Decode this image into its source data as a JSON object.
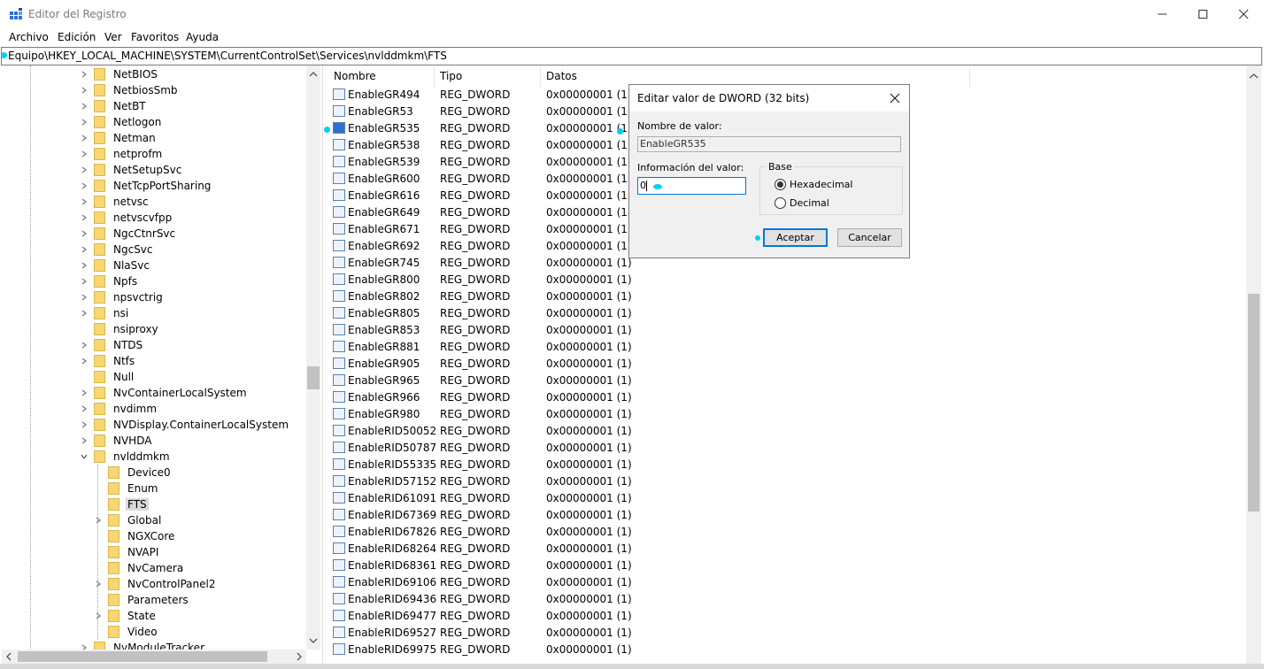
{
  "window": {
    "title": "Editor del Registro"
  },
  "menu": [
    "Archivo",
    "Edición",
    "Ver",
    "Favoritos",
    "Ayuda"
  ],
  "address": "Equipo\\HKEY_LOCAL_MACHINE\\SYSTEM\\CurrentControlSet\\Services\\nvlddmkm\\FTS",
  "tree": {
    "top_level": [
      "NetBIOS",
      "NetbiosSmb",
      "NetBT",
      "Netlogon",
      "Netman",
      "netprofm",
      "NetSetupSvc",
      "NetTcpPortSharing",
      "netvsc",
      "netvscvfpp",
      "NgcCtnrSvc",
      "NgcSvc",
      "NlaSvc",
      "Npfs",
      "npsvctrig",
      "nsi",
      "nsiproxy",
      "NTDS",
      "Ntfs",
      "Null",
      "NvContainerLocalSystem",
      "nvdimm",
      "NVDisplay.ContainerLocalSystem",
      "NVHDA",
      "nvlddmkm"
    ],
    "children": [
      "Device0",
      "Enum",
      "FTS",
      "Global",
      "NGXCore",
      "NVAPI",
      "NvCamera",
      "NvControlPanel2",
      "Parameters",
      "State",
      "Video"
    ],
    "after": "NvModuleTracker",
    "selected": "FTS"
  },
  "list": {
    "headers": {
      "name": "Nombre",
      "type": "Tipo",
      "data": "Datos"
    },
    "rows": [
      {
        "name": "EnableGR494",
        "type": "REG_DWORD",
        "data": "0x00000001 (1)"
      },
      {
        "name": "EnableGR53",
        "type": "REG_DWORD",
        "data": "0x00000001 (1)"
      },
      {
        "name": "EnableGR535",
        "type": "REG_DWORD",
        "data": "0x00000001 (1)"
      },
      {
        "name": "EnableGR538",
        "type": "REG_DWORD",
        "data": "0x00000001 (1)"
      },
      {
        "name": "EnableGR539",
        "type": "REG_DWORD",
        "data": "0x00000001 (1)"
      },
      {
        "name": "EnableGR600",
        "type": "REG_DWORD",
        "data": "0x00000001 (1)"
      },
      {
        "name": "EnableGR616",
        "type": "REG_DWORD",
        "data": "0x00000001 (1)"
      },
      {
        "name": "EnableGR649",
        "type": "REG_DWORD",
        "data": "0x00000001 (1)"
      },
      {
        "name": "EnableGR671",
        "type": "REG_DWORD",
        "data": "0x00000001 (1)"
      },
      {
        "name": "EnableGR692",
        "type": "REG_DWORD",
        "data": "0x00000001 (1)"
      },
      {
        "name": "EnableGR745",
        "type": "REG_DWORD",
        "data": "0x00000001 (1)"
      },
      {
        "name": "EnableGR800",
        "type": "REG_DWORD",
        "data": "0x00000001 (1)"
      },
      {
        "name": "EnableGR802",
        "type": "REG_DWORD",
        "data": "0x00000001 (1)"
      },
      {
        "name": "EnableGR805",
        "type": "REG_DWORD",
        "data": "0x00000001 (1)"
      },
      {
        "name": "EnableGR853",
        "type": "REG_DWORD",
        "data": "0x00000001 (1)"
      },
      {
        "name": "EnableGR881",
        "type": "REG_DWORD",
        "data": "0x00000001 (1)"
      },
      {
        "name": "EnableGR905",
        "type": "REG_DWORD",
        "data": "0x00000001 (1)"
      },
      {
        "name": "EnableGR965",
        "type": "REG_DWORD",
        "data": "0x00000001 (1)"
      },
      {
        "name": "EnableGR966",
        "type": "REG_DWORD",
        "data": "0x00000001 (1)"
      },
      {
        "name": "EnableGR980",
        "type": "REG_DWORD",
        "data": "0x00000001 (1)"
      },
      {
        "name": "EnableRID50052",
        "type": "REG_DWORD",
        "data": "0x00000001 (1)"
      },
      {
        "name": "EnableRID50787",
        "type": "REG_DWORD",
        "data": "0x00000001 (1)"
      },
      {
        "name": "EnableRID55335",
        "type": "REG_DWORD",
        "data": "0x00000001 (1)"
      },
      {
        "name": "EnableRID57152",
        "type": "REG_DWORD",
        "data": "0x00000001 (1)"
      },
      {
        "name": "EnableRID61091",
        "type": "REG_DWORD",
        "data": "0x00000001 (1)"
      },
      {
        "name": "EnableRID67369",
        "type": "REG_DWORD",
        "data": "0x00000001 (1)"
      },
      {
        "name": "EnableRID67826",
        "type": "REG_DWORD",
        "data": "0x00000001 (1)"
      },
      {
        "name": "EnableRID68264",
        "type": "REG_DWORD",
        "data": "0x00000001 (1)"
      },
      {
        "name": "EnableRID68361",
        "type": "REG_DWORD",
        "data": "0x00000001 (1)"
      },
      {
        "name": "EnableRID69106",
        "type": "REG_DWORD",
        "data": "0x00000001 (1)"
      },
      {
        "name": "EnableRID69436",
        "type": "REG_DWORD",
        "data": "0x00000001 (1)"
      },
      {
        "name": "EnableRID69477",
        "type": "REG_DWORD",
        "data": "0x00000001 (1)"
      },
      {
        "name": "EnableRID69527",
        "type": "REG_DWORD",
        "data": "0x00000001 (1)"
      },
      {
        "name": "EnableRID69975",
        "type": "REG_DWORD",
        "data": "0x00000001 (1)"
      }
    ],
    "selected": "EnableGR535",
    "icon_glyph": "011 110"
  },
  "dialog": {
    "title": "Editar valor de DWORD (32 bits)",
    "name_label": "Nombre de valor:",
    "name_value": "EnableGR535",
    "data_label": "Información del valor:",
    "data_value": "0",
    "base_label": "Base",
    "hex_label": "Hexadecimal",
    "dec_label": "Decimal",
    "base_selected": "Hexadecimal",
    "ok_label": "Aceptar",
    "cancel_label": "Cancelar"
  },
  "colors": {
    "highlight_dot": "#00d0f0",
    "accent": "#0078d7",
    "folder": "#f7d774"
  }
}
